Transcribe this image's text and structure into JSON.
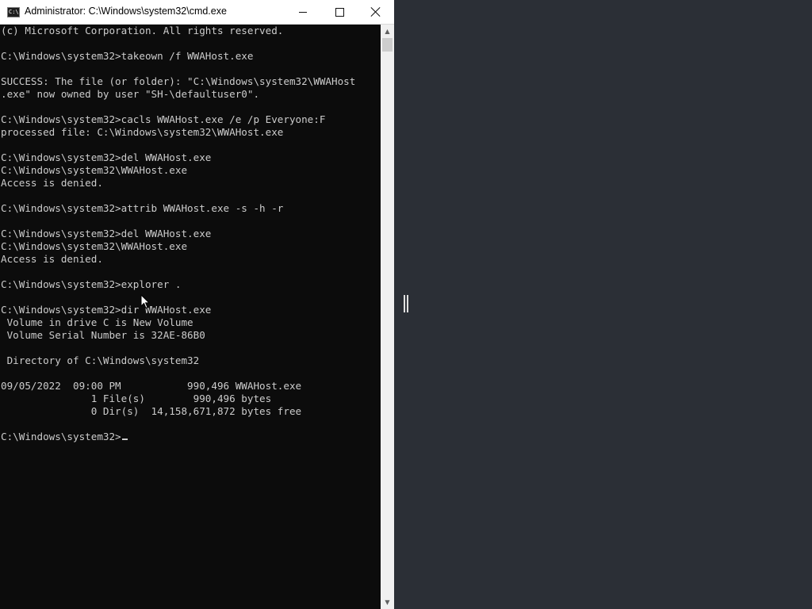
{
  "window": {
    "title": "Administrator: C:\\Windows\\system32\\cmd.exe",
    "icon_text": "C:\\",
    "icons": {
      "app": "cmd-icon",
      "minimize": "minimize-icon",
      "maximize": "maximize-icon",
      "close": "close-icon"
    }
  },
  "console": {
    "lines": [
      "(c) Microsoft Corporation. All rights reserved.",
      "",
      "C:\\Windows\\system32>takeown /f WWAHost.exe",
      "",
      "SUCCESS: The file (or folder): \"C:\\Windows\\system32\\WWAHost",
      ".exe\" now owned by user \"SH-\\defaultuser0\".",
      "",
      "C:\\Windows\\system32>cacls WWAHost.exe /e /p Everyone:F",
      "processed file: C:\\Windows\\system32\\WWAHost.exe",
      "",
      "C:\\Windows\\system32>del WWAHost.exe",
      "C:\\Windows\\system32\\WWAHost.exe",
      "Access is denied.",
      "",
      "C:\\Windows\\system32>attrib WWAHost.exe -s -h -r",
      "",
      "C:\\Windows\\system32>del WWAHost.exe",
      "C:\\Windows\\system32\\WWAHost.exe",
      "Access is denied.",
      "",
      "C:\\Windows\\system32>explorer .",
      "",
      "C:\\Windows\\system32>dir WWAHost.exe",
      " Volume in drive C is New Volume",
      " Volume Serial Number is 32AE-86B0",
      "",
      " Directory of C:\\Windows\\system32",
      "",
      "09/05/2022  09:00 PM           990,496 WWAHost.exe",
      "               1 File(s)        990,496 bytes",
      "               0 Dir(s)  14,158,671,872 bytes free",
      "",
      "C:\\Windows\\system32>"
    ]
  },
  "colors": {
    "console_bg": "#0c0c0c",
    "console_fg": "#cccccc",
    "desktop_bg": "#2b2f36",
    "titlebar_bg": "#ffffff"
  }
}
